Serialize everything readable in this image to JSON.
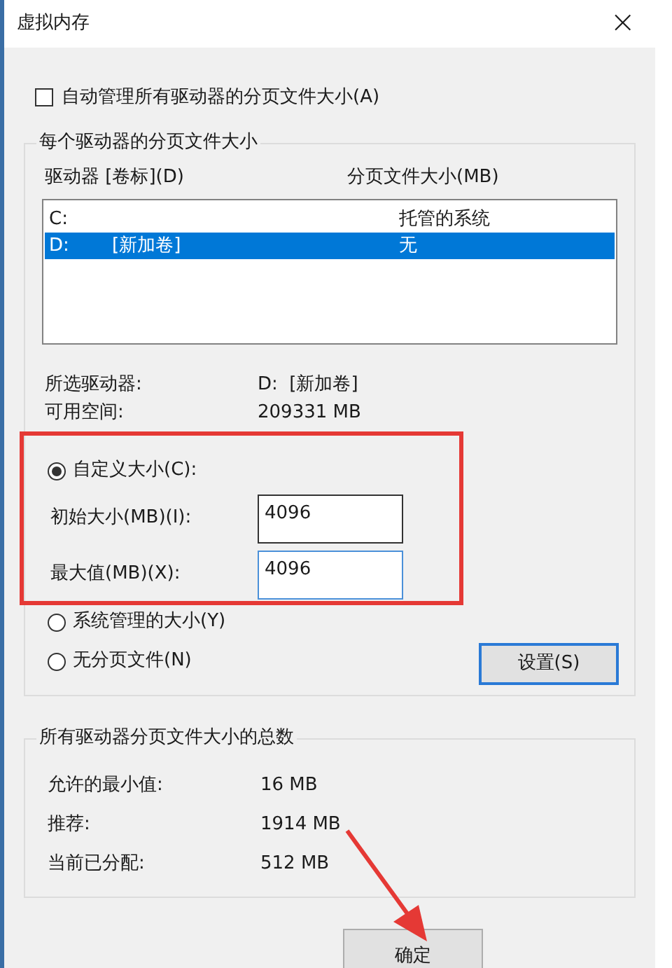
{
  "window": {
    "title": "虚拟内存",
    "close": "×"
  },
  "auto_manage": {
    "label": "自动管理所有驱动器的分页文件大小(A)",
    "checked": false
  },
  "drives_group": {
    "title": "每个驱动器的分页文件大小",
    "columns": [
      "驱动器 [卷标](D)",
      "分页文件大小(MB)"
    ],
    "rows": [
      {
        "drive": "C:",
        "label": "",
        "size": "托管的系统",
        "selected": false
      },
      {
        "drive": "D:",
        "label": "[新加卷]",
        "size": "无",
        "selected": true
      }
    ],
    "info": [
      {
        "label": "所选驱动器:",
        "value": "D:  [新加卷]"
      },
      {
        "label": "可用空间:",
        "value": "209331 MB"
      }
    ],
    "options": [
      {
        "kind": "radio",
        "label": "自定义大小(C):",
        "selected": true
      },
      {
        "kind": "field",
        "label": "初始大小(MB)(I):",
        "value": "4096",
        "focused": false
      },
      {
        "kind": "field",
        "label": "最大值(MB)(X):",
        "value": "4096",
        "focused": true
      },
      {
        "kind": "radio",
        "label": "系统管理的大小(Y)",
        "selected": false
      },
      {
        "kind": "radio",
        "label": "无分页文件(N)",
        "selected": false
      }
    ],
    "set_button": "设置(S)"
  },
  "totals_group": {
    "title": "所有驱动器分页文件大小的总数",
    "rows": [
      {
        "label": "允许的最小值:",
        "value": "16 MB"
      },
      {
        "label": "推荐:",
        "value": "1914 MB"
      },
      {
        "label": "当前已分配:",
        "value": "512 MB"
      }
    ]
  },
  "buttons": [
    "确定"
  ]
}
